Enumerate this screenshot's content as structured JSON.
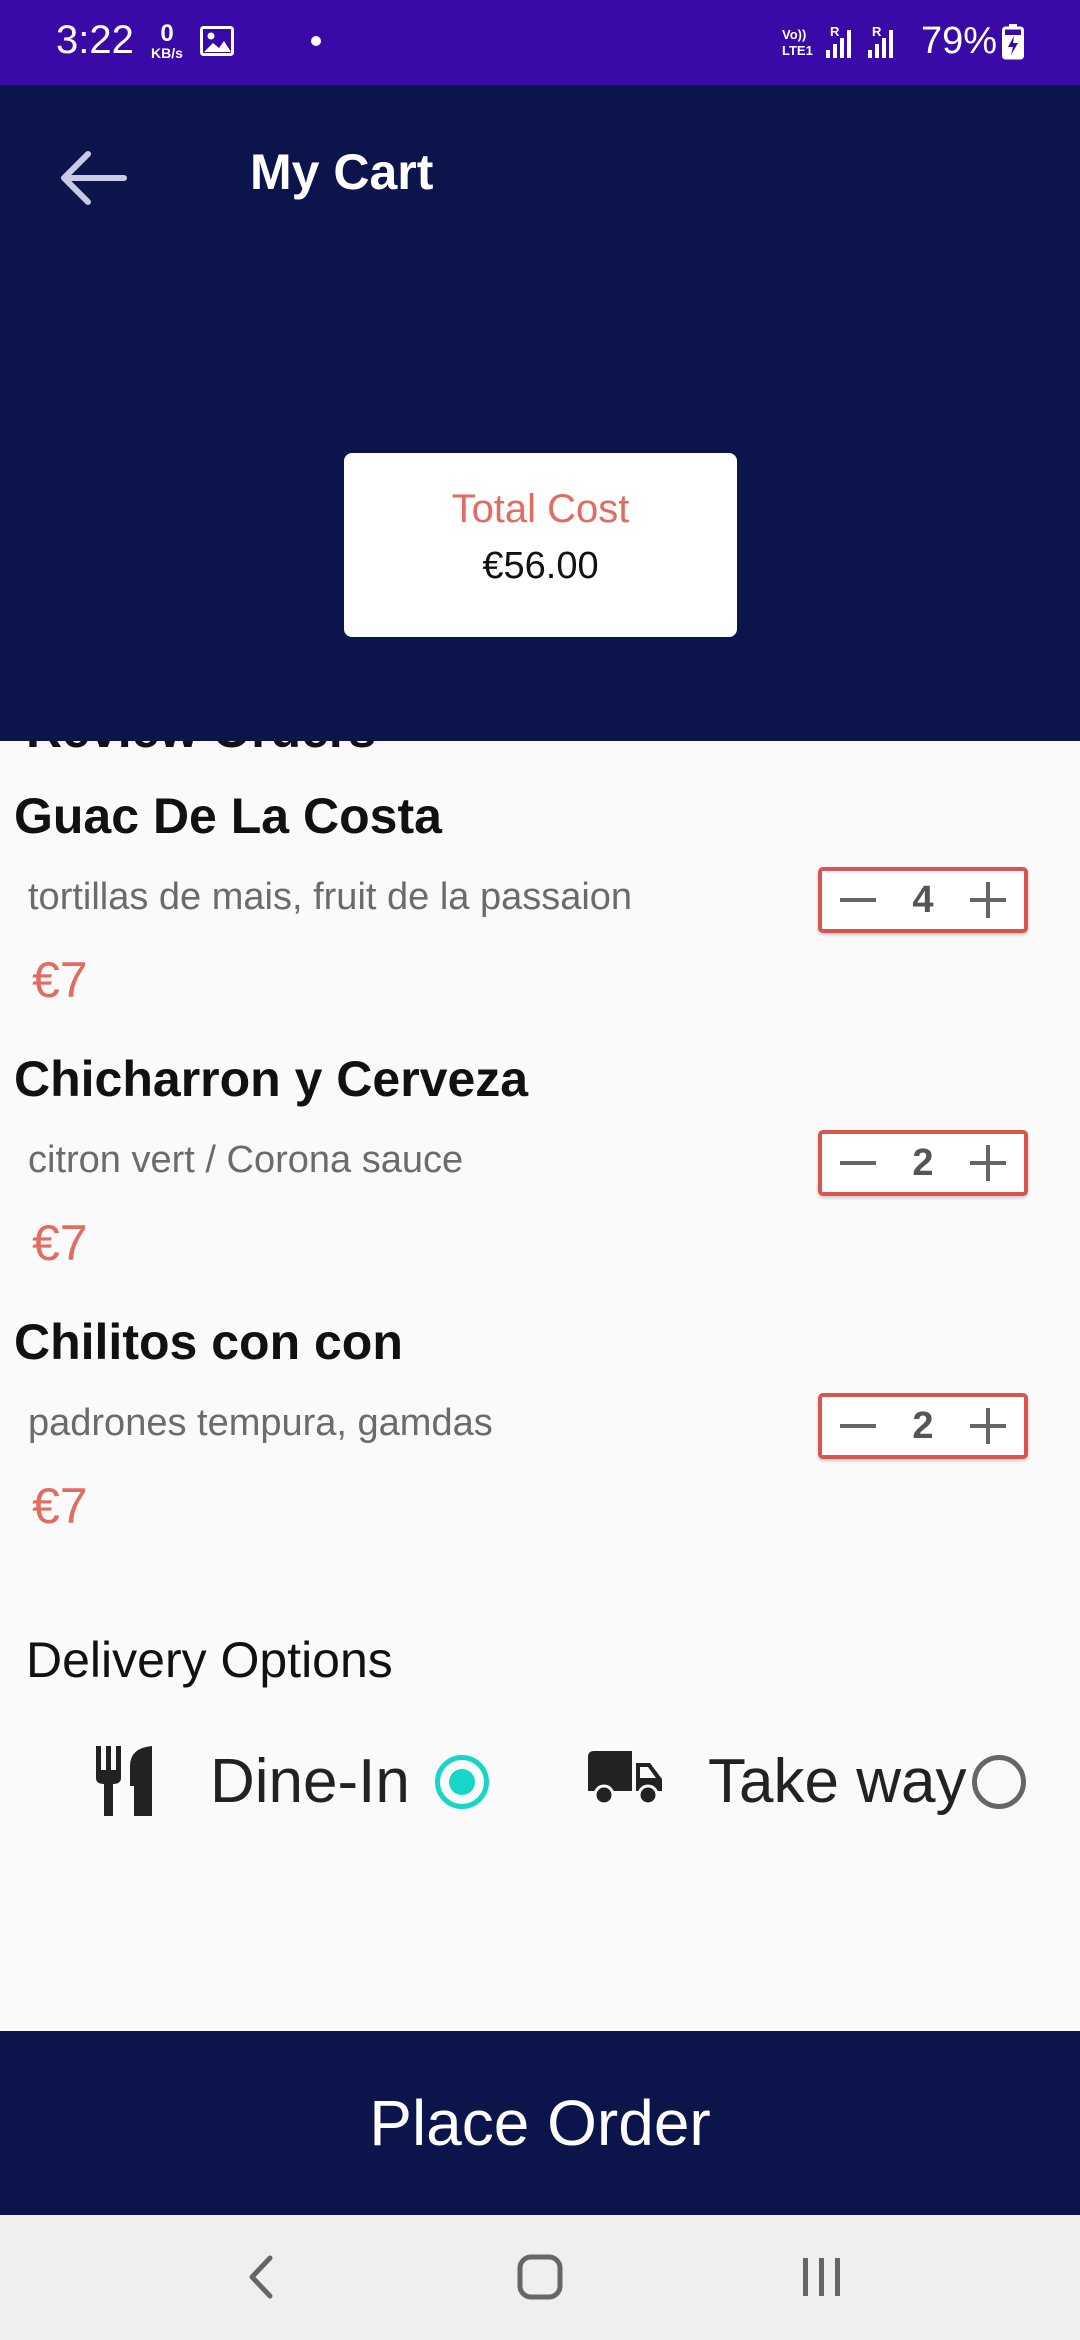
{
  "status_bar": {
    "time": "3:22",
    "net_speed_value": "0",
    "net_speed_unit": "KB/s",
    "battery_percent": "79%"
  },
  "header": {
    "title": "My Cart",
    "total_label": "Total Cost",
    "total_value": "€56.00"
  },
  "section_title": "Review Orders",
  "items": [
    {
      "name": "Guac De La Costa",
      "description": "tortillas de mais, fruit de la passaion",
      "price": "€7",
      "quantity": "4"
    },
    {
      "name": "Chicharron y Cerveza",
      "description": "citron vert / Corona sauce",
      "price": "€7",
      "quantity": "2"
    },
    {
      "name": "Chilitos con con",
      "description": "padrones tempura, gamdas",
      "price": "€7",
      "quantity": "2"
    }
  ],
  "delivery": {
    "title": "Delivery Options",
    "options": [
      {
        "label": "Dine-In",
        "icon": "fork-knife-icon",
        "selected": true
      },
      {
        "label": "Take way",
        "icon": "truck-icon",
        "selected": false
      }
    ]
  },
  "place_order_label": "Place Order",
  "colors": {
    "status_bar": "#3a0aa8",
    "header": "#0c154b",
    "accent": "#e26b62",
    "radio_selected": "#16d6c8"
  }
}
